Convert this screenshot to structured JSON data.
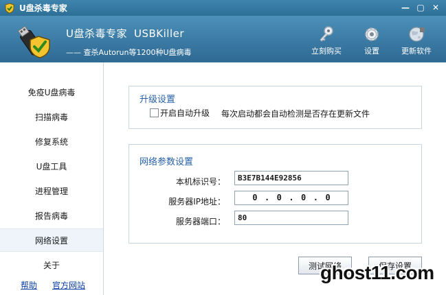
{
  "window": {
    "title": "U盘杀毒专家",
    "min_icon": "minimize-icon",
    "max_icon": "maximize-icon",
    "close_icon": "close-icon"
  },
  "header": {
    "title_cn": "U盘杀毒专家",
    "title_en": "USBKiller",
    "subtitle": "—— 查杀Autorun等1200种U盘病毒",
    "tools": [
      {
        "label": "立刻购买",
        "icon": "key-icon"
      },
      {
        "label": "设置",
        "icon": "gear-icon"
      },
      {
        "label": "更新软件",
        "icon": "globe-icon"
      }
    ]
  },
  "sidebar": {
    "items": [
      {
        "label": "免疫U盘病毒"
      },
      {
        "label": "扫描病毒"
      },
      {
        "label": "修复系统"
      },
      {
        "label": "U盘工具"
      },
      {
        "label": "进程管理"
      },
      {
        "label": "报告病毒"
      },
      {
        "label": "网络设置"
      },
      {
        "label": "关于"
      }
    ],
    "active_index": 6,
    "footer": {
      "help": "帮助",
      "website": "官方网站"
    }
  },
  "upgrade": {
    "title": "升级设置",
    "checkbox_label": "开启自动升级",
    "checked": false,
    "description": "每次启动都会自动检测是否存在更新文件"
  },
  "network": {
    "title": "网络参数设置",
    "machine_id_label": "本机标识号：",
    "machine_id_value": "B3E7B144E92856",
    "server_ip_label": "服务器IP地址：",
    "server_ip": [
      "0",
      "0",
      "0",
      "0"
    ],
    "server_port_label": "服务器端口：",
    "server_port_value": "80"
  },
  "buttons": {
    "test": "测试网络",
    "save": "保存设置"
  },
  "watermark": "ghost11.com",
  "colors": {
    "header": "#3b7aa4",
    "accent_text": "#2660a6",
    "link": "#0b3fa8"
  }
}
